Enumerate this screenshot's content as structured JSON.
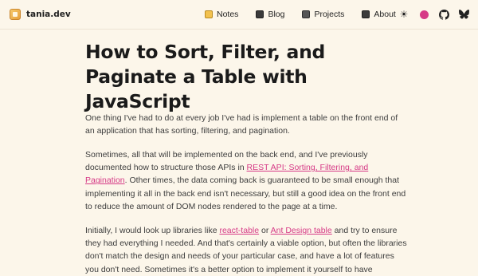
{
  "brand": {
    "name": "tania.dev"
  },
  "nav": {
    "items": [
      {
        "label": "Notes",
        "icon": "notebook-icon"
      },
      {
        "label": "Blog",
        "icon": "blog-icon"
      },
      {
        "label": "Projects",
        "icon": "projects-icon"
      },
      {
        "label": "About",
        "icon": "about-icon"
      }
    ]
  },
  "actions": {
    "theme_icon": "sun-icon",
    "accent_icon": "color-dot-icon",
    "github_icon": "github-icon",
    "bluesky_icon": "bluesky-icon"
  },
  "colors": {
    "background": "#fcf6ea",
    "link": "#d63a86",
    "accent_dot": "#d63a86"
  },
  "article": {
    "title": "How to Sort, Filter, and Paginate a Table with JavaScript",
    "p1": "One thing I've had to do at every job I've had is implement a table on the front end of an application that has sorting, filtering, and pagination.",
    "p2_start": "Sometimes, all that will be implemented on the back end, and I've previously documented how to structure those APIs in ",
    "p2_link": "REST API: Sorting, Filtering, and Pagination",
    "p2_end": ". Other times, the data coming back is guaranteed to be small enough that implementing it all in the back end isn't necessary, but still a good idea on the front end to reduce the amount of DOM nodes rendered to the page at a time.",
    "p3_start": "Initially, I would look up libraries like ",
    "p3_link1": "react-table",
    "p3_mid": " or ",
    "p3_link2": "Ant Design table",
    "p3_end": " and try to ensure they had everything I needed. And that's certainly a viable option, but often the libraries don't match the design and needs of your particular case, and have a lot of features you don't need. Sometimes it's a better option to implement it yourself to have"
  }
}
